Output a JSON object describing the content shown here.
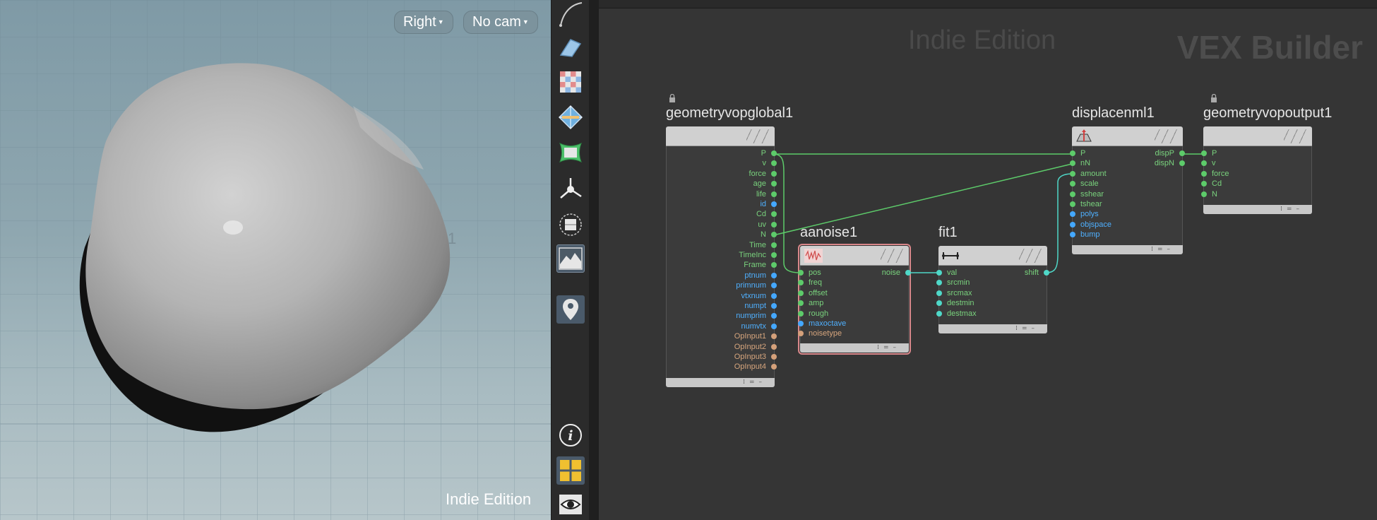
{
  "viewport": {
    "view_menu_label": "Right",
    "camera_menu_label": "No cam",
    "watermark": "Indie Edition"
  },
  "toolbar": {
    "tools": [
      "curve-tool-icon",
      "plane-tool-icon",
      "checker-uv-icon",
      "diamond-grid-icon",
      "green-patch-icon",
      "light-rig-icon",
      "dashed-circle-icon",
      "landscape-icon",
      "location-pin-icon",
      "info-icon",
      "viewport-layout-icon",
      "eye-icon"
    ]
  },
  "network": {
    "watermark": "Indie Edition",
    "context_label": "VEX Builder",
    "nodes": {
      "global": {
        "title": "geometryvopglobal1",
        "outputs": [
          {
            "label": "P",
            "color": "green"
          },
          {
            "label": "v",
            "color": "green"
          },
          {
            "label": "force",
            "color": "green"
          },
          {
            "label": "age",
            "color": "green"
          },
          {
            "label": "life",
            "color": "green"
          },
          {
            "label": "id",
            "color": "blue"
          },
          {
            "label": "Cd",
            "color": "green"
          },
          {
            "label": "uv",
            "color": "green"
          },
          {
            "label": "N",
            "color": "green"
          },
          {
            "label": "Time",
            "color": "green"
          },
          {
            "label": "TimeInc",
            "color": "green"
          },
          {
            "label": "Frame",
            "color": "green"
          },
          {
            "label": "ptnum",
            "color": "blue"
          },
          {
            "label": "primnum",
            "color": "blue"
          },
          {
            "label": "vtxnum",
            "color": "blue"
          },
          {
            "label": "numpt",
            "color": "blue"
          },
          {
            "label": "numprim",
            "color": "blue"
          },
          {
            "label": "numvtx",
            "color": "blue"
          },
          {
            "label": "OpInput1",
            "color": "tan"
          },
          {
            "label": "OpInput2",
            "color": "tan"
          },
          {
            "label": "OpInput3",
            "color": "tan"
          },
          {
            "label": "OpInput4",
            "color": "tan"
          }
        ]
      },
      "aanoise": {
        "title": "aanoise1",
        "inputs": [
          {
            "label": "pos",
            "color": "green"
          },
          {
            "label": "freq",
            "color": "green"
          },
          {
            "label": "offset",
            "color": "green"
          },
          {
            "label": "amp",
            "color": "green"
          },
          {
            "label": "rough",
            "color": "green"
          },
          {
            "label": "maxoctave",
            "color": "blue"
          },
          {
            "label": "noisetype",
            "color": "tan"
          }
        ],
        "outputs": [
          {
            "label": "noise",
            "color": "green"
          }
        ]
      },
      "fit": {
        "title": "fit1",
        "inputs": [
          {
            "label": "val",
            "color": "green"
          },
          {
            "label": "srcmin",
            "color": "green"
          },
          {
            "label": "srcmax",
            "color": "green"
          },
          {
            "label": "destmin",
            "color": "green"
          },
          {
            "label": "destmax",
            "color": "green"
          }
        ],
        "outputs": [
          {
            "label": "shift",
            "color": "green"
          }
        ]
      },
      "displace": {
        "title": "displacenml1",
        "inputs": [
          {
            "label": "P",
            "color": "green"
          },
          {
            "label": "nN",
            "color": "green"
          },
          {
            "label": "amount",
            "color": "green"
          },
          {
            "label": "scale",
            "color": "green"
          },
          {
            "label": "sshear",
            "color": "green"
          },
          {
            "label": "tshear",
            "color": "green"
          },
          {
            "label": "polys",
            "color": "blue"
          },
          {
            "label": "objspace",
            "color": "blue"
          },
          {
            "label": "bump",
            "color": "blue"
          }
        ],
        "outputs": [
          {
            "label": "dispP",
            "color": "green"
          },
          {
            "label": "dispN",
            "color": "green"
          }
        ]
      },
      "output": {
        "title": "geometryvopoutput1",
        "inputs": [
          {
            "label": "P",
            "color": "green"
          },
          {
            "label": "v",
            "color": "green"
          },
          {
            "label": "force",
            "color": "green"
          },
          {
            "label": "Cd",
            "color": "green"
          },
          {
            "label": "N",
            "color": "green"
          }
        ]
      }
    }
  }
}
